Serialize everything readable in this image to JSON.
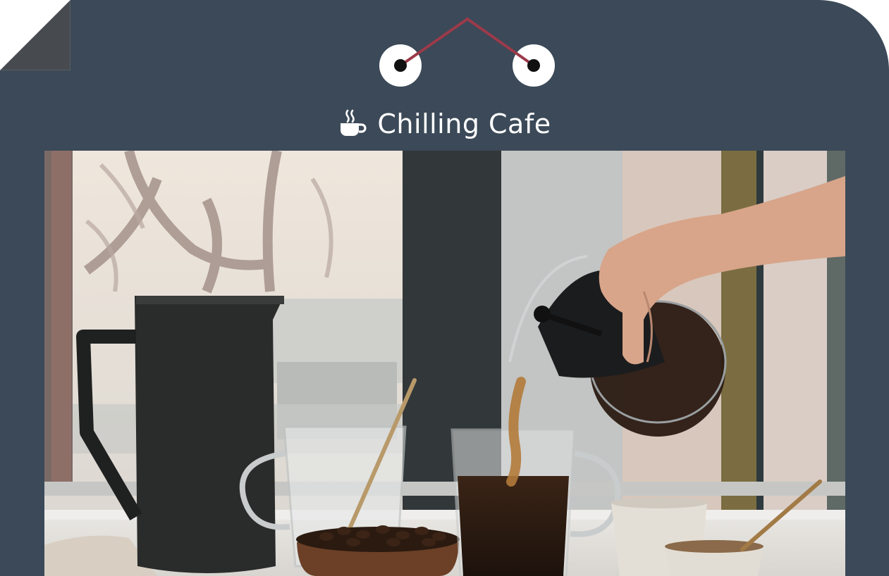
{
  "header": {
    "title": "Chilling Cafe",
    "title_icon": "coffee-cup-icon"
  },
  "colors": {
    "background": "#3b4958",
    "accent": "#9b3a4a",
    "page": "#ffffff"
  }
}
